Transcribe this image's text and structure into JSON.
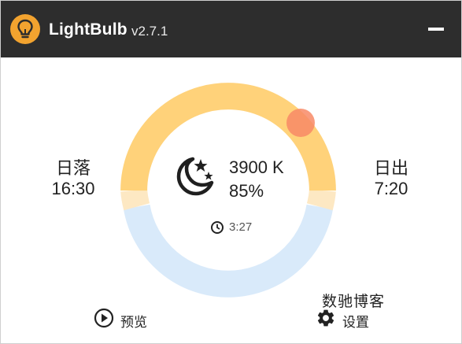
{
  "titlebar": {
    "app_name": "LightBulb",
    "version": "v2.7.1",
    "icon": "lightbulb-icon",
    "minimize_icon": "minimize-icon"
  },
  "dial": {
    "day_color": "#ffd27a",
    "night_color": "#d9eafa",
    "transition_color": "#fde8c3",
    "handle_color": "#f88a66"
  },
  "sunset": {
    "label": "日落",
    "time": "16:30"
  },
  "sunrise": {
    "label": "日出",
    "time": "7:20"
  },
  "status": {
    "icon": "moon-stars-icon",
    "temperature": "3900 K",
    "brightness": "85%",
    "clock_icon": "clock-icon",
    "time_until": "3:27"
  },
  "footer": {
    "preview_label": "预览",
    "preview_icon": "play-circle-icon",
    "settings_label": "设置",
    "settings_icon": "gear-icon",
    "watermark": "数驰博客"
  }
}
